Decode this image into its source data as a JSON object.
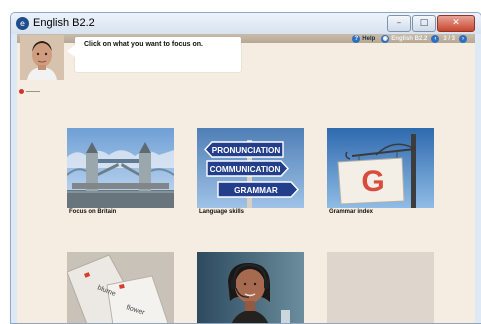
{
  "window": {
    "title": "English B2.2",
    "icon": "app-logo-icon",
    "buttons": {
      "minimize": "–",
      "maximize": "□",
      "close": "✕"
    }
  },
  "toolbar": {
    "help_label": "Help",
    "course_label": "English B2.2",
    "page_indicator": "3 / 3"
  },
  "assistant": {
    "message": "Click on what you want to focus on."
  },
  "tiles": [
    {
      "caption": "Focus on Britain",
      "image": "tower-bridge-photo"
    },
    {
      "caption": "Language skills",
      "image": "language-signs-photo",
      "signs": [
        "PRONUNCIATION",
        "COMMUNICATION",
        "GRAMMAR"
      ]
    },
    {
      "caption": "Grammar index",
      "image": "grammar-sign-photo",
      "letter": "G"
    },
    {
      "caption": "",
      "image": "index-cards-photo",
      "words": [
        "blume",
        "flower"
      ]
    },
    {
      "caption": "",
      "image": "headset-operator-photo"
    }
  ],
  "colors": {
    "content_bg": "#f6ede2",
    "accent_blue": "#2f6fc2",
    "sign_blue": "#1f3d8f",
    "red": "#d2322d"
  }
}
